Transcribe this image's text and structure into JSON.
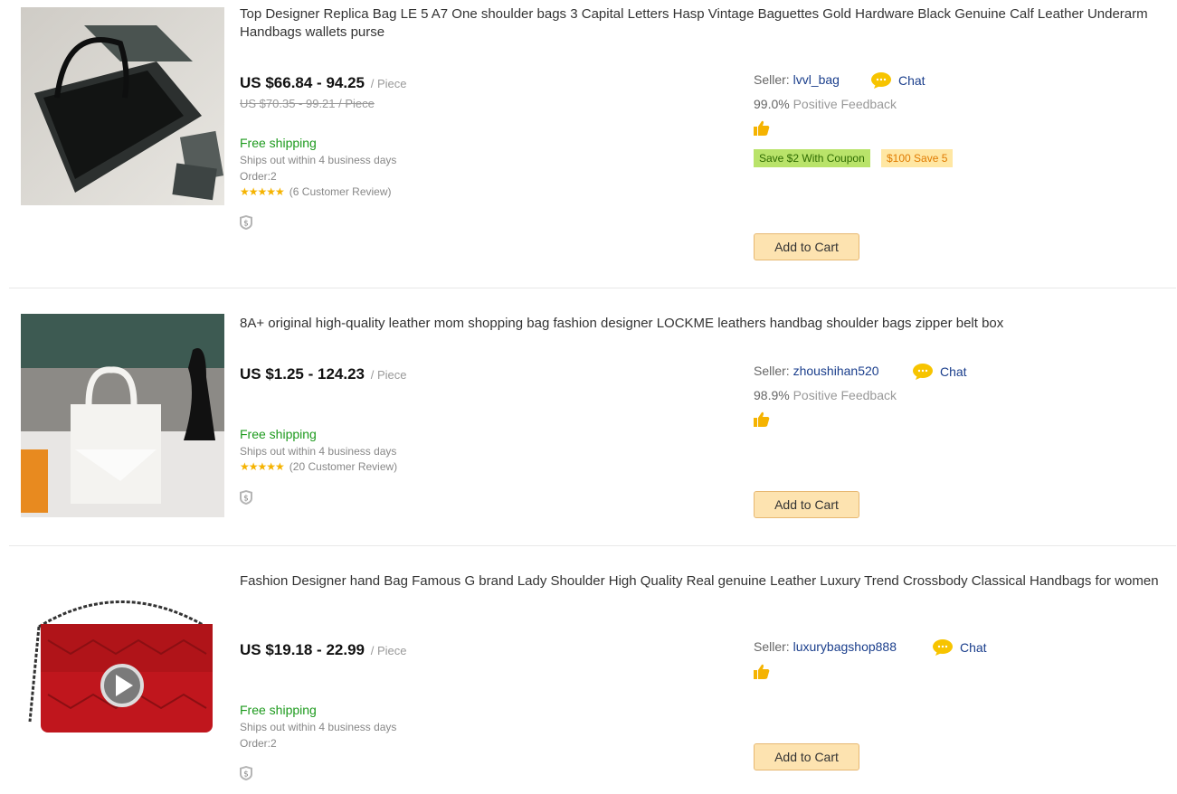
{
  "items": [
    {
      "title": "Top Designer Replica Bag LE 5 A7 One shoulder bags 3 Capital Letters Hasp Vintage Baguettes Gold Hardware Black Genuine Calf Leather Underarm Handbags wallets purse",
      "price": "US $66.84 - 94.25",
      "unit": "/ Piece",
      "old_price": "US $70.35 - 99.21 / Piece",
      "shipping": "Free shipping",
      "ships_out": "Ships out within 4 business days",
      "orders": "Order:2",
      "reviews": "(6 Customer Review)",
      "rating_stars": 5,
      "seller_label": "Seller:",
      "seller_name": "lvvl_bag",
      "chat": "Chat",
      "feedback_pct": "99.0%",
      "feedback_label": "Positive Feedback",
      "coupons": [
        "Save $2 With Coupon",
        "$100 Save 5"
      ],
      "cart": "Add to Cart"
    },
    {
      "title": "8A+ original high-quality leather mom shopping bag fashion designer LOCKME leathers handbag shoulder bags zipper belt box",
      "price": "US $1.25 - 124.23",
      "unit": "/ Piece",
      "shipping": "Free shipping",
      "ships_out": "Ships out within 4 business days",
      "reviews": "(20 Customer Review)",
      "rating_stars": 5,
      "seller_label": "Seller:",
      "seller_name": "zhoushihan520",
      "chat": "Chat",
      "feedback_pct": "98.9%",
      "feedback_label": "Positive Feedback",
      "cart": "Add to Cart"
    },
    {
      "title": "Fashion Designer hand Bag Famous G brand Lady Shoulder High Quality Real genuine Leather Luxury Trend Crossbody Classical Handbags for women",
      "price": "US $19.18 - 22.99",
      "unit": "/ Piece",
      "shipping": "Free shipping",
      "ships_out": "Ships out within 4 business days",
      "orders": "Order:2",
      "seller_label": "Seller:",
      "seller_name": "luxurybagshop888",
      "chat": "Chat",
      "cart": "Add to Cart"
    }
  ],
  "colors": {
    "shipping": "#1d9a1d",
    "link": "#1a3e8c",
    "cart_bg": "#fde3b0",
    "star": "#f5b301"
  },
  "icons": [
    "chat-bubble-icon",
    "thumbs-up-icon",
    "shield-dollar-icon",
    "play-icon",
    "star-icon"
  ]
}
